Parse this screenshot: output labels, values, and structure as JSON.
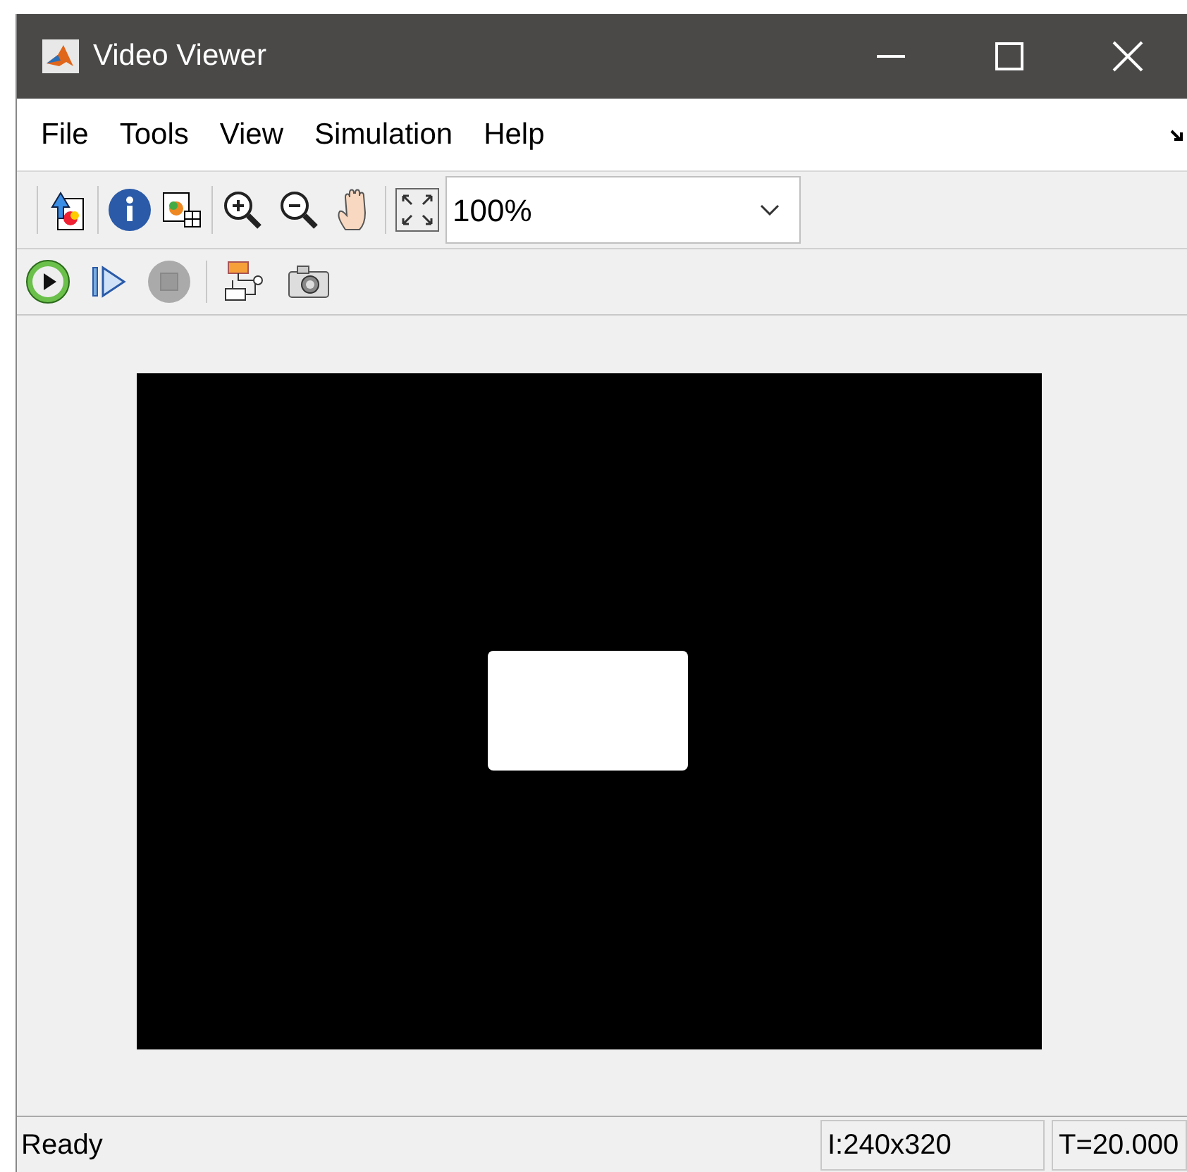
{
  "window": {
    "title": "Video Viewer"
  },
  "menu": [
    "File",
    "Tools",
    "View",
    "Simulation",
    "Help"
  ],
  "zoom": {
    "value": "100%"
  },
  "status_bar": {
    "message": "Ready",
    "size": "I:240x320",
    "time": "T=20.000"
  }
}
